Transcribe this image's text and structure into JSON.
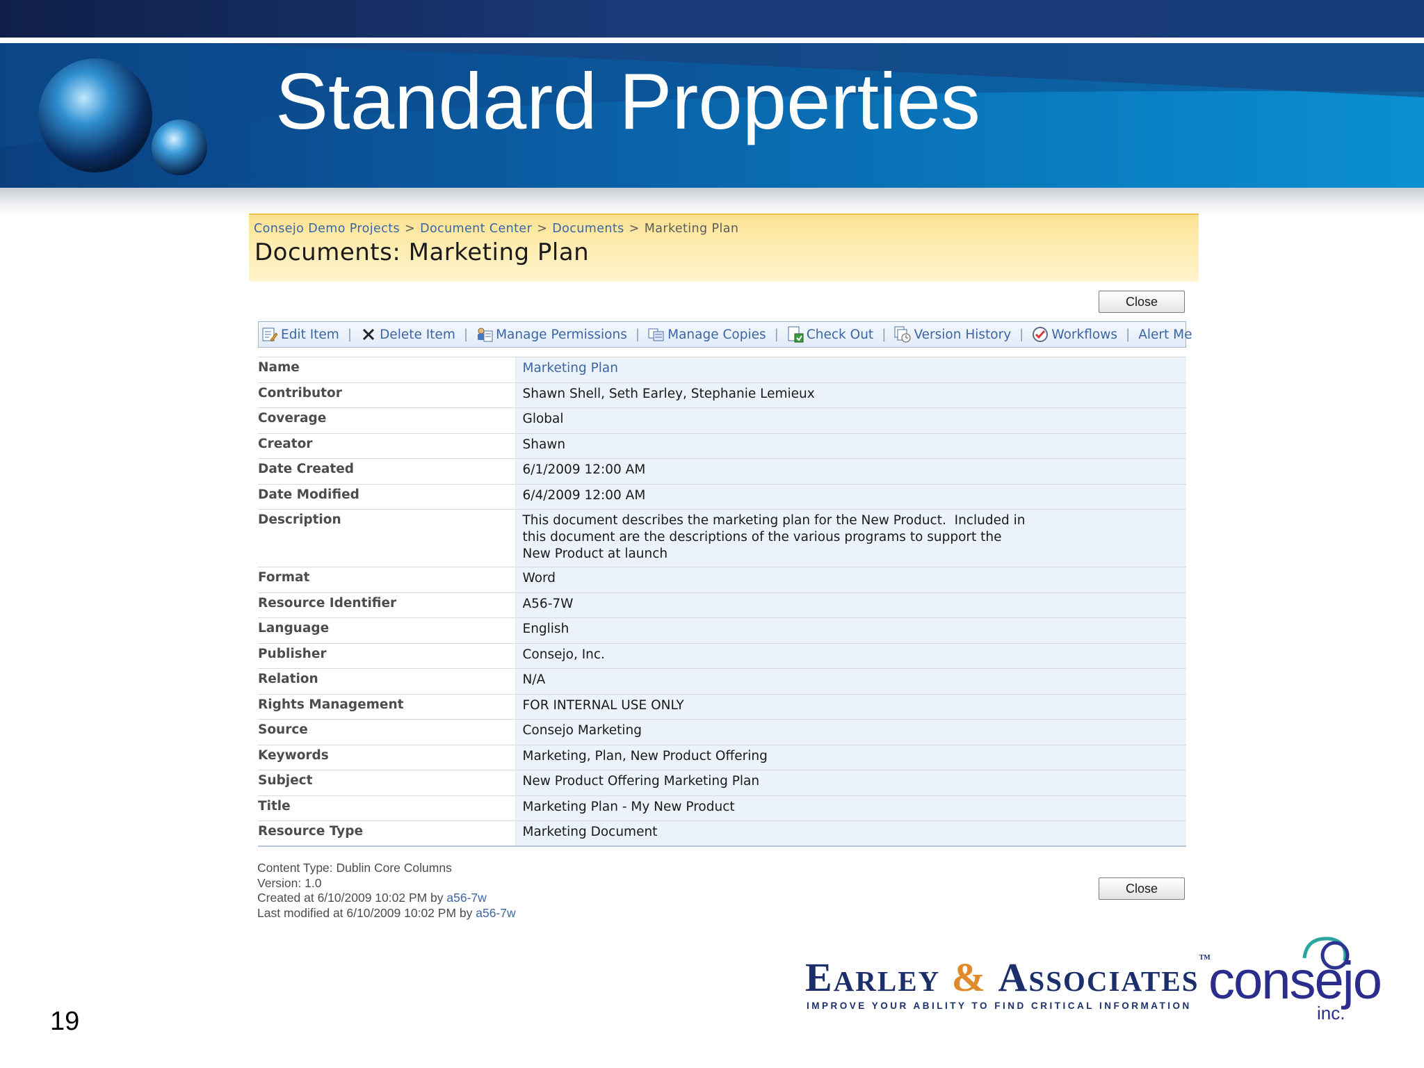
{
  "slide": {
    "title": "Standard Properties",
    "number": "19"
  },
  "breadcrumb": {
    "items": [
      "Consejo Demo Projects",
      "Document Center",
      "Documents"
    ],
    "current": "Marketing Plan",
    "separator": ">"
  },
  "page_title": "Documents: Marketing Plan",
  "close_label": "Close",
  "toolbar": {
    "items": [
      {
        "label": "Edit Item",
        "icon": "edit-icon"
      },
      {
        "label": "Delete Item",
        "icon": "delete-icon"
      },
      {
        "label": "Manage Permissions",
        "icon": "permissions-icon"
      },
      {
        "label": "Manage Copies",
        "icon": "copies-icon"
      },
      {
        "label": "Check Out",
        "icon": "check-out-icon"
      },
      {
        "label": "Version History",
        "icon": "version-history-icon"
      },
      {
        "label": "Workflows",
        "icon": "workflows-icon"
      },
      {
        "label": "Alert Me",
        "icon": ""
      }
    ],
    "separator": "|"
  },
  "properties": [
    {
      "label": "Name",
      "value": "Marketing Plan",
      "link": true
    },
    {
      "label": "Contributor",
      "value": "Shawn Shell, Seth Earley, Stephanie Lemieux"
    },
    {
      "label": "Coverage",
      "value": "Global"
    },
    {
      "label": "Creator",
      "value": "Shawn"
    },
    {
      "label": "Date Created",
      "value": "6/1/2009 12:00 AM"
    },
    {
      "label": "Date Modified",
      "value": "6/4/2009 12:00 AM"
    },
    {
      "label": "Description",
      "lines": [
        "This document describes the marketing plan for the New Product.  Included in",
        "this document are the descriptions of the various programs to support the",
        "New Product at launch"
      ]
    },
    {
      "label": "Format",
      "value": "Word"
    },
    {
      "label": "Resource Identifier",
      "value": "A56-7W"
    },
    {
      "label": "Language",
      "value": "English"
    },
    {
      "label": "Publisher",
      "value": "Consejo, Inc."
    },
    {
      "label": "Relation",
      "value": "N/A"
    },
    {
      "label": "Rights Management",
      "value": "FOR INTERNAL USE ONLY"
    },
    {
      "label": "Source",
      "value": "Consejo Marketing"
    },
    {
      "label": "Keywords",
      "value": "Marketing, Plan, New Product Offering"
    },
    {
      "label": "Subject",
      "value": "New Product Offering Marketing Plan"
    },
    {
      "label": "Title",
      "value": "Marketing Plan - My New Product"
    },
    {
      "label": "Resource Type",
      "value": "Marketing Document"
    }
  ],
  "footer": {
    "content_type": "Content Type: Dublin Core Columns",
    "version": "Version: 1.0",
    "created_prefix": "Created at 6/10/2009 10:02 PM  by ",
    "created_user": "a56-7w",
    "modified_prefix": "Last modified at 6/10/2009 10:02 PM  by ",
    "modified_user": "a56-7w"
  },
  "logos": {
    "earley_word1": "Earley",
    "earley_amp": "&",
    "earley_word2": "Associates",
    "earley_tm": "TM",
    "earley_tagline": "IMPROVE YOUR ABILITY TO FIND CRITICAL INFORMATION",
    "consejo_name": "consejo",
    "consejo_suffix": "inc."
  },
  "colors": {
    "link": "#3b66a6",
    "header_yellow": "#fdeaa8",
    "value_cell": "#ecf2fa",
    "banner_blue": "#0b5aa0"
  }
}
